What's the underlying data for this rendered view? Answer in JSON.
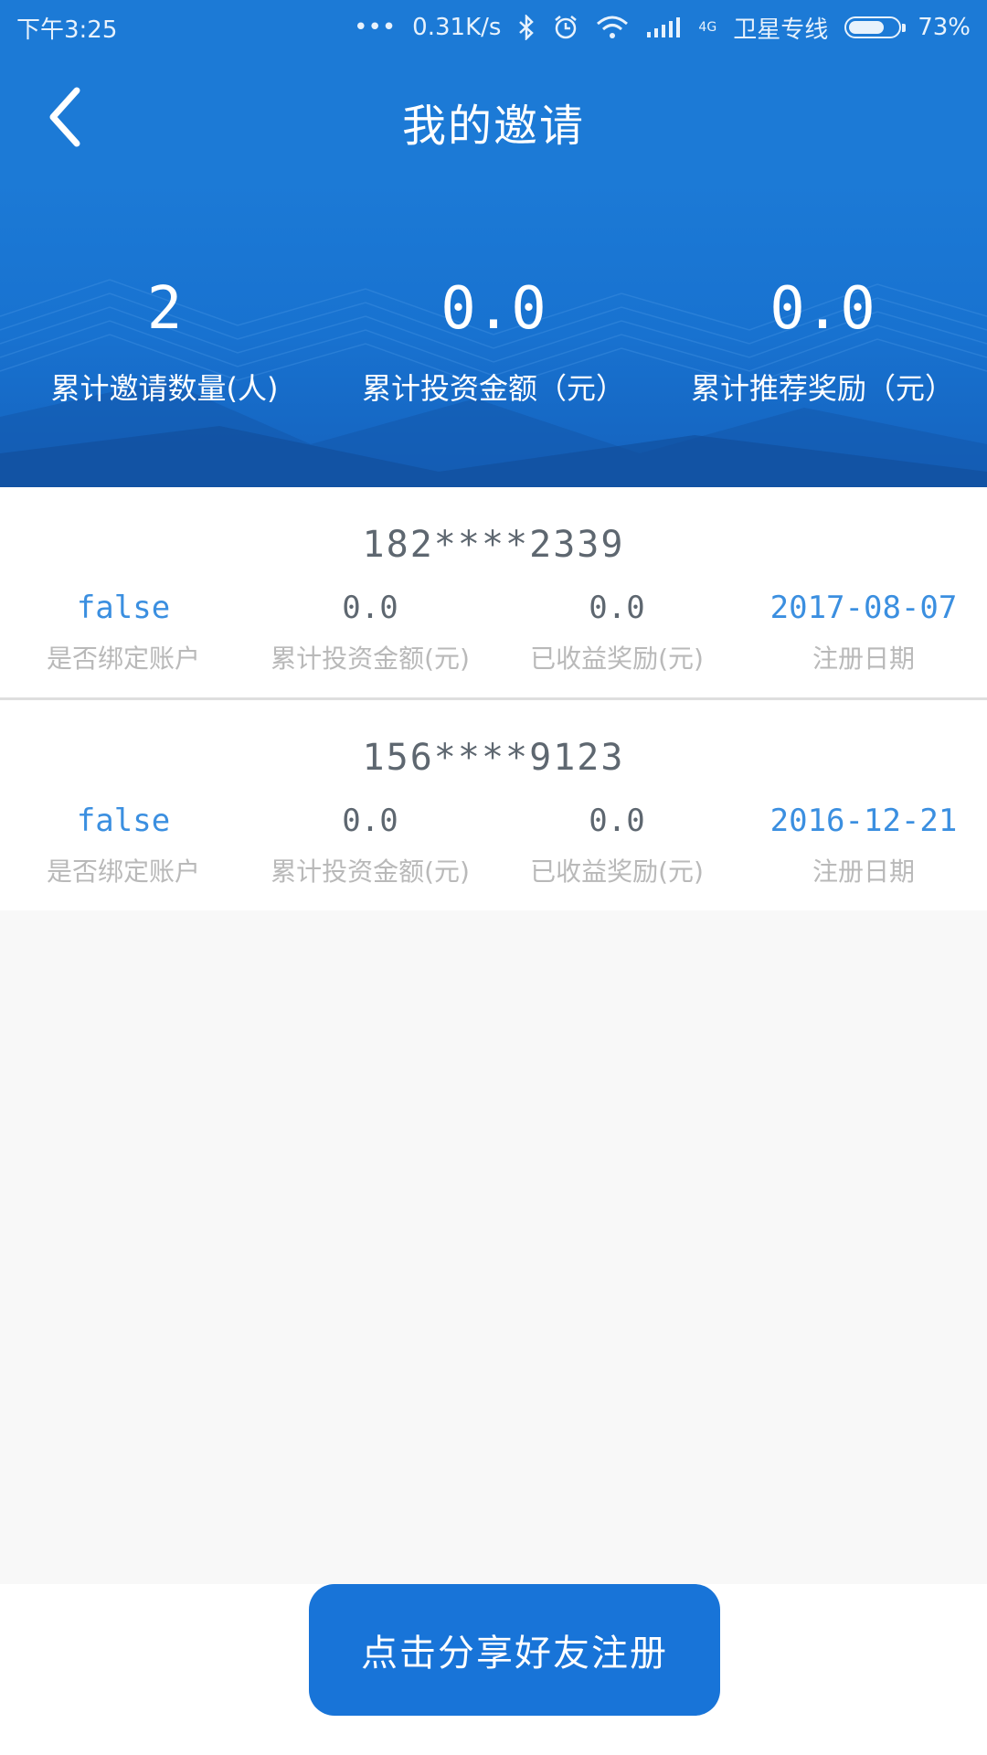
{
  "status_bar": {
    "time": "下午3:25",
    "dots": "•••",
    "net_speed": "0.31K/s",
    "signal_label": "4G",
    "carrier": "卫星专线",
    "battery": "73%",
    "battery_level": 0.73
  },
  "header": {
    "title": "我的邀请",
    "back_icon": "chevron-left-icon"
  },
  "summary": {
    "invite_count": "2",
    "invite_count_label": "累计邀请数量(人)",
    "invest_total": "0.0",
    "invest_total_label": "累计投资金额（元）",
    "reward_total": "0.0",
    "reward_total_label": "累计推荐奖励（元）"
  },
  "invites": [
    {
      "phone": "182****2339",
      "bound": "false",
      "bound_label": "是否绑定账户",
      "invest": "0.0",
      "invest_label": "累计投资金额(元)",
      "reward": "0.0",
      "reward_label": "已收益奖励(元)",
      "date": "2017-08-07",
      "date_label": "注册日期"
    },
    {
      "phone": "156****9123",
      "bound": "false",
      "bound_label": "是否绑定账户",
      "invest": "0.0",
      "invest_label": "累计投资金额(元)",
      "reward": "0.0",
      "reward_label": "已收益奖励(元)",
      "date": "2016-12-21",
      "date_label": "注册日期"
    }
  ],
  "share_button": "点击分享好友注册",
  "colors": {
    "primary": "#1c7ad6",
    "button": "#1874d8",
    "value_blue": "#3b8fe0",
    "label_gray": "#b9b9b9"
  }
}
